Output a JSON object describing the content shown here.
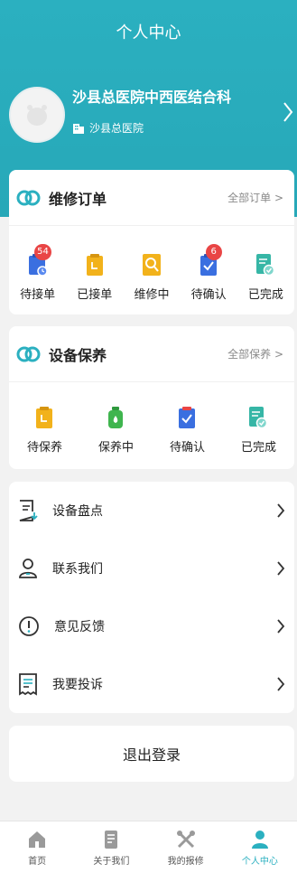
{
  "header": {
    "title": "个人中心"
  },
  "profile": {
    "org_name": "沙县总医院中西医结合科",
    "hospital": "沙县总医院"
  },
  "repair_orders": {
    "title": "维修订单",
    "more": "全部订单 >",
    "items": [
      {
        "label": "待接单",
        "badge": "54",
        "icon": "clipboard-clock-icon",
        "color": "#3a6fe0"
      },
      {
        "label": "已接单",
        "badge": "",
        "icon": "clipboard-icon",
        "color": "#f2b21b"
      },
      {
        "label": "维修中",
        "badge": "",
        "icon": "wrench-icon",
        "color": "#f2b21b"
      },
      {
        "label": "待确认",
        "badge": "6",
        "icon": "checklist-icon",
        "color": "#3a6fe0"
      },
      {
        "label": "已完成",
        "badge": "",
        "icon": "doc-check-icon",
        "color": "#36b6a6"
      }
    ]
  },
  "maintenance": {
    "title": "设备保养",
    "more": "全部保养 >",
    "items": [
      {
        "label": "待保养",
        "icon": "clipboard-icon",
        "color": "#f2b21b"
      },
      {
        "label": "保养中",
        "icon": "bottle-icon",
        "color": "#3fb54e"
      },
      {
        "label": "待确认",
        "icon": "checklist-icon",
        "color": "#3a6fe0"
      },
      {
        "label": "已完成",
        "icon": "doc-check-icon",
        "color": "#36b6a6"
      }
    ]
  },
  "menu": [
    {
      "label": "设备盘点",
      "icon": "inventory-icon"
    },
    {
      "label": "联系我们",
      "icon": "person-icon"
    },
    {
      "label": "意见反馈",
      "icon": "alert-icon"
    },
    {
      "label": "我要投诉",
      "icon": "receipt-icon"
    }
  ],
  "logout": "退出登录",
  "tabbar": [
    {
      "label": "首页",
      "icon": "home-icon",
      "active": false
    },
    {
      "label": "关于我们",
      "icon": "about-icon",
      "active": false
    },
    {
      "label": "我的报修",
      "icon": "tools-icon",
      "active": false
    },
    {
      "label": "个人中心",
      "icon": "user-icon",
      "active": true
    }
  ],
  "colors": {
    "primary": "#2bb0c0",
    "badge": "#e94545",
    "blue": "#3a6fe0",
    "yellow": "#f2b21b",
    "green": "#3fb54e",
    "teal": "#36b6a6"
  }
}
